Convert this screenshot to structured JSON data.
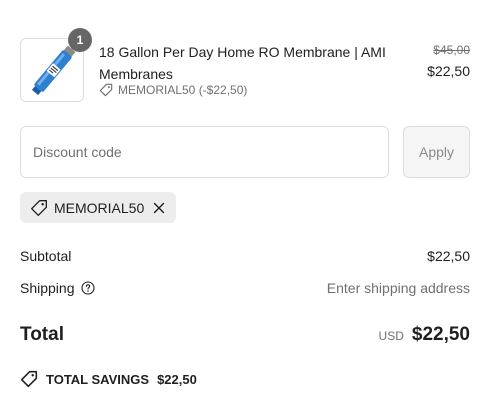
{
  "line_item": {
    "quantity": "1",
    "title": "18 Gallon Per Day Home RO Membrane | AMI Membranes",
    "discount_label": "MEMORIAL50 (-$22,50)",
    "original_price": "$45,00",
    "price": "$22,50",
    "thumbnail_icon": "ro-membrane-product-image"
  },
  "discount": {
    "placeholder": "Discount code",
    "apply_label": "Apply",
    "applied_code": "MEMORIAL50"
  },
  "summary": {
    "subtotal_label": "Subtotal",
    "subtotal_value": "$22,50",
    "shipping_label": "Shipping",
    "shipping_value": "Enter shipping address",
    "total_label": "Total",
    "currency": "USD",
    "total_value": "$22,50",
    "savings_label": "TOTAL SAVINGS",
    "savings_value": "$22,50"
  },
  "colors": {
    "text": "#1f1f1f",
    "muted": "#707070",
    "border": "#dedede",
    "chip_bg": "#ededed",
    "badge_bg": "#666666",
    "membrane_blue": "#2f7fd1"
  }
}
